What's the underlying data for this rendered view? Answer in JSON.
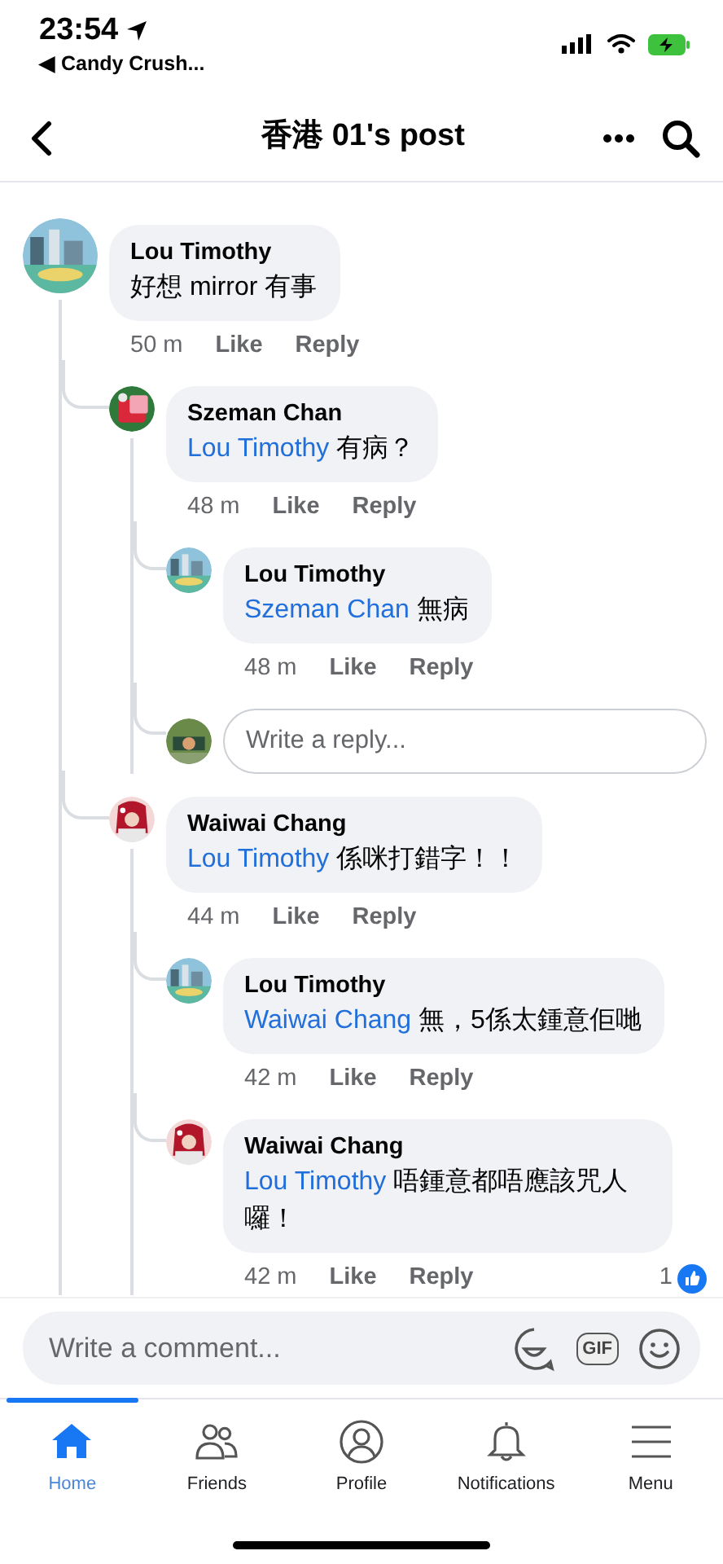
{
  "status_bar": {
    "time": "23:54",
    "back_app": "◀ Candy Crush..."
  },
  "header": {
    "title": "香港 01's post"
  },
  "comments": [
    {
      "author": "Lou Timothy",
      "text": "好想 mirror 有事",
      "time": "50 m",
      "like": "Like",
      "reply": "Reply",
      "children": [
        {
          "author": "Szeman Chan",
          "mention": "Lou Timothy",
          "text": "有病？",
          "time": "48 m",
          "like": "Like",
          "reply": "Reply",
          "children": [
            {
              "author": "Lou Timothy",
              "mention": "Szeman Chan",
              "text": "無病",
              "time": "48 m",
              "like": "Like",
              "reply": "Reply"
            }
          ],
          "reply_box": {
            "placeholder": "Write a reply..."
          }
        },
        {
          "author": "Waiwai Chang",
          "mention": "Lou Timothy",
          "text": "係咪打錯字！！",
          "time": "44 m",
          "like": "Like",
          "reply": "Reply",
          "children": [
            {
              "author": "Lou Timothy",
              "mention": "Waiwai Chang",
              "text": "無，5係太鍾意佢哋",
              "time": "42 m",
              "like": "Like",
              "reply": "Reply"
            },
            {
              "author": "Waiwai Chang",
              "mention": "Lou Timothy",
              "text": "唔鍾意都唔應該咒人囉！",
              "time": "42 m",
              "like": "Like",
              "reply": "Reply",
              "reaction_count": "1"
            }
          ]
        }
      ]
    }
  ],
  "comment_bar": {
    "placeholder": "Write a comment...",
    "gif_label": "GIF"
  },
  "tabs": [
    {
      "label": "Home",
      "selected": true
    },
    {
      "label": "Friends",
      "selected": false
    },
    {
      "label": "Profile",
      "selected": false
    },
    {
      "label": "Notifications",
      "selected": false
    },
    {
      "label": "Menu",
      "selected": false
    }
  ]
}
